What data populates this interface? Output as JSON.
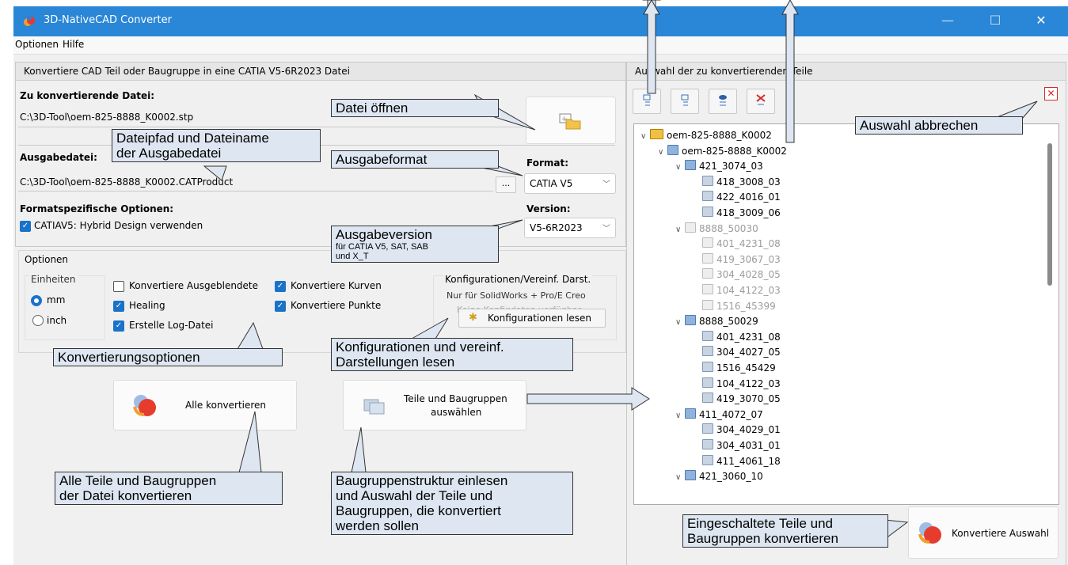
{
  "window": {
    "title": "3D-NativeCAD Converter",
    "minimize": "—",
    "maximize": "☐",
    "close": "✕"
  },
  "menu": {
    "items": [
      "Optionen",
      "Hilfe"
    ]
  },
  "left_panel": {
    "header": "Konvertiere CAD Teil oder Baugruppe in eine CATIA V5-6R2023 Datei",
    "input_label": "Zu konvertierende Datei:",
    "input_path": "C:\\3D-Tool\\oem-825-8888_K0002.stp",
    "output_label": "Ausgabedatei:",
    "output_path": "C:\\3D-Tool\\oem-825-8888_K0002.CATProduct",
    "browse_label": "...",
    "format_label": "Format:",
    "format_value": "CATIA V5",
    "format_specific_label": "Formatspezifische Optionen:",
    "hybrid_option": "CATIAV5: Hybrid Design verwenden",
    "version_label": "Version:",
    "version_value": "V5-6R2023"
  },
  "options": {
    "group_label": "Optionen",
    "units_label": "Einheiten",
    "unit_mm": "mm",
    "unit_inch": "inch",
    "chk_hidden": "Konvertiere Ausgeblendete",
    "chk_healing": "Healing",
    "chk_log": "Erstelle Log-Datei",
    "chk_curves": "Konvertiere Kurven",
    "chk_points": "Konvertiere Punkte",
    "config_group": "Konfigurationen/Vereinf. Darst.",
    "config_note": "Nur für SolidWorks + Pro/E Creo",
    "config_none": "Keine Konfigdaten verfügbar",
    "config_button": "Konfigurationen lesen"
  },
  "actions": {
    "convert_all": "Alle konvertieren",
    "select_parts_line1": "Teile und Baugruppen",
    "select_parts_line2": "auswählen",
    "convert_selection": "Konvertiere Auswahl"
  },
  "right_panel": {
    "header": "Auswahl der zu konvertierenden Teile",
    "tree": [
      {
        "label": "oem-825-8888_K0002",
        "level": 0,
        "kind": "root",
        "expanded": true
      },
      {
        "label": "oem-825-8888_K0002",
        "level": 1,
        "kind": "asm",
        "expanded": true
      },
      {
        "label": "421_3074_03",
        "level": 2,
        "kind": "asm",
        "expanded": true
      },
      {
        "label": "418_3008_03",
        "level": 3,
        "kind": "part"
      },
      {
        "label": "422_4016_01",
        "level": 3,
        "kind": "part"
      },
      {
        "label": "418_3009_06",
        "level": 3,
        "kind": "part"
      },
      {
        "label": "8888_50030",
        "level": 2,
        "kind": "asm-x",
        "expanded": true,
        "disabled": true
      },
      {
        "label": "401_4231_08",
        "level": 3,
        "kind": "part-x",
        "disabled": true
      },
      {
        "label": "419_3067_03",
        "level": 3,
        "kind": "part-x",
        "disabled": true
      },
      {
        "label": "304_4028_05",
        "level": 3,
        "kind": "part-x",
        "disabled": true
      },
      {
        "label": "104_4122_03",
        "level": 3,
        "kind": "part-x",
        "disabled": true
      },
      {
        "label": "1516_45399",
        "level": 3,
        "kind": "part-x",
        "disabled": true
      },
      {
        "label": "8888_50029",
        "level": 2,
        "kind": "asm",
        "expanded": true
      },
      {
        "label": "401_4231_08",
        "level": 3,
        "kind": "part"
      },
      {
        "label": "304_4027_05",
        "level": 3,
        "kind": "part"
      },
      {
        "label": "1516_45429",
        "level": 3,
        "kind": "part"
      },
      {
        "label": "104_4122_03",
        "level": 3,
        "kind": "part"
      },
      {
        "label": "419_3070_05",
        "level": 3,
        "kind": "part"
      },
      {
        "label": "411_4072_07",
        "level": 2,
        "kind": "asm",
        "expanded": true
      },
      {
        "label": "304_4029_01",
        "level": 3,
        "kind": "part"
      },
      {
        "label": "304_4031_01",
        "level": 3,
        "kind": "part"
      },
      {
        "label": "411_4061_18",
        "level": 3,
        "kind": "part"
      },
      {
        "label": "421_3060_10",
        "level": 2,
        "kind": "asm",
        "expanded": true
      }
    ]
  },
  "callouts": {
    "open_file": "Datei öffnen",
    "output_path_l1": "Dateipfad und Dateiname",
    "output_path_l2": "der Ausgabedatei",
    "output_format": "Ausgabeformat",
    "output_version": "Ausgabeversion",
    "output_version_sub1": "für CATIA V5, SAT, SAB",
    "output_version_sub2": "und X_T",
    "cancel_selection": "Auswahl abbrechen",
    "conversion_options": "Konvertierungsoptionen",
    "configs_l1": "Konfigurationen und vereinf.",
    "configs_l2": "Darstellungen lesen",
    "convert_all_l1": "Alle Teile und Baugruppen",
    "convert_all_l2": "der Datei konvertieren",
    "structure_l1": "Baugruppenstruktur einlesen",
    "structure_l2": "und Auswahl der Teile und",
    "structure_l3": "Baugruppen, die konvertiert",
    "structure_l4": "werden sollen",
    "convert_sel_l1": "Eingeschaltete Teile und",
    "convert_sel_l2": "Baugruppen konvertieren"
  }
}
